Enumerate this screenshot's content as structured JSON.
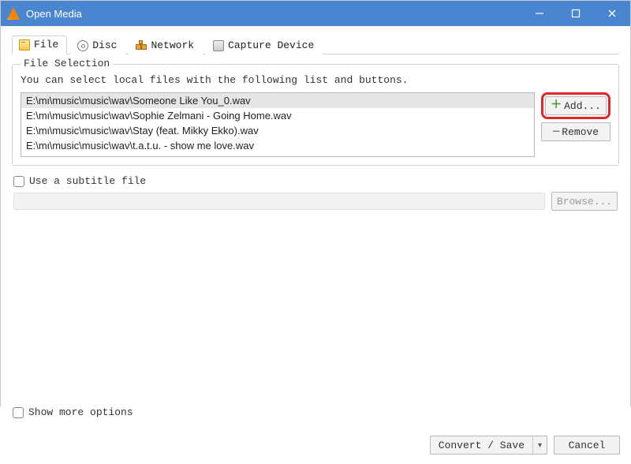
{
  "window": {
    "title": "Open Media"
  },
  "tabs": {
    "file": "File",
    "disc": "Disc",
    "network": "Network",
    "capture": "Capture Device"
  },
  "fileSelection": {
    "legend": "File Selection",
    "help": "You can select local files with the following list and buttons.",
    "files": [
      "E:\\mι\\music\\music\\wav\\Someone Like You_0.wav",
      "E:\\mι\\music\\music\\wav\\Sophie Zelmani - Going Home.wav",
      "E:\\mι\\music\\music\\wav\\Stay (feat. Mikky Ekko).wav",
      "E:\\mι\\music\\music\\wav\\t.a.t.u. - show me love.wav"
    ],
    "addLabel": "Add...",
    "removeLabel": "Remove"
  },
  "subtitle": {
    "checkboxLabel": "Use a subtitle file",
    "browseLabel": "Browse..."
  },
  "footer": {
    "showMore": "Show more options",
    "convertSave": "Convert / Save",
    "cancel": "Cancel"
  }
}
